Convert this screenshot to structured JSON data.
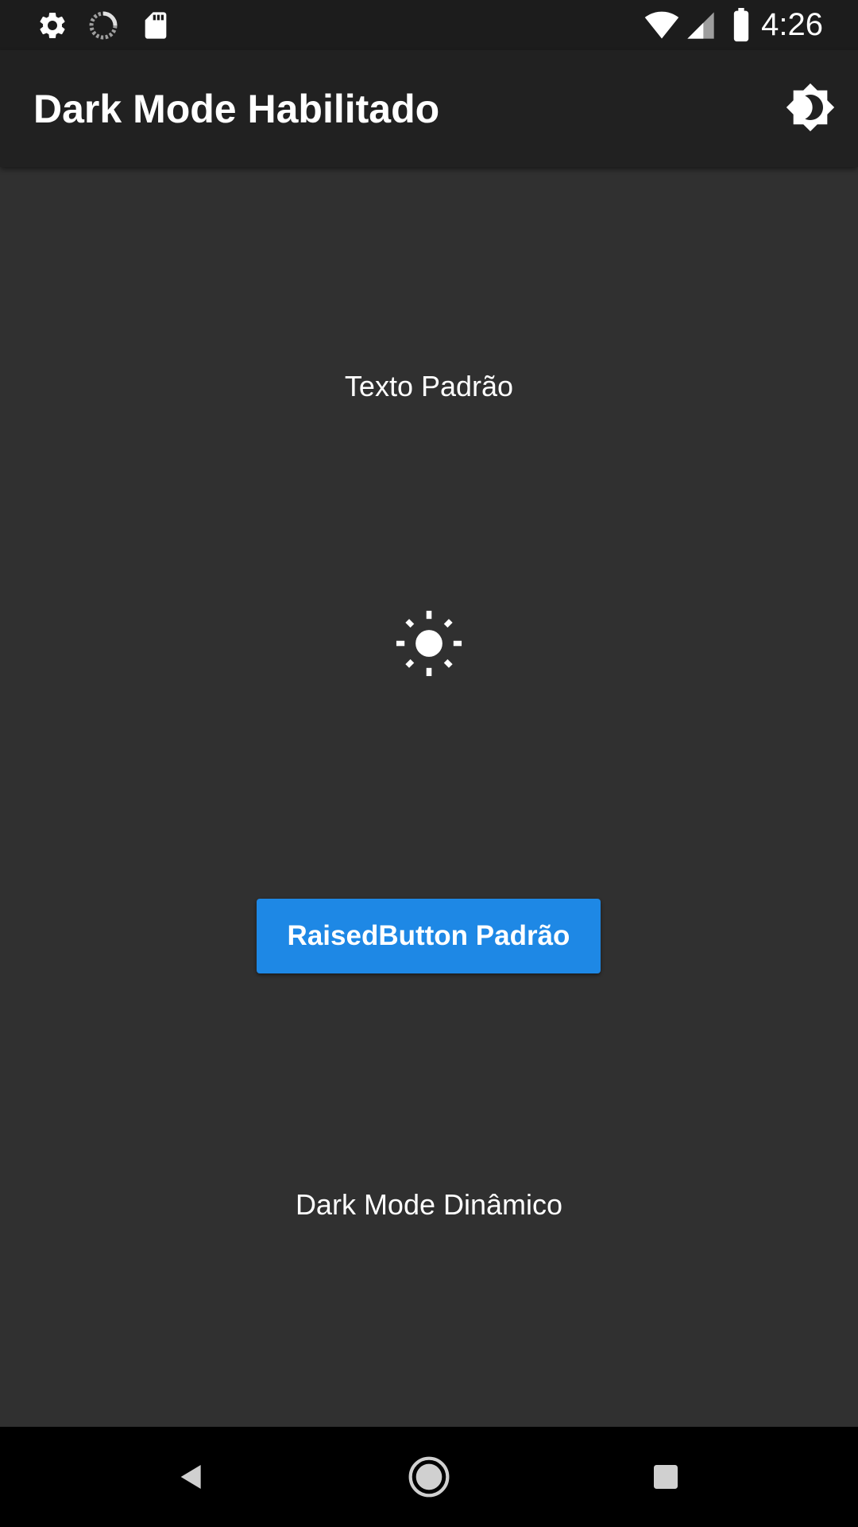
{
  "status_bar": {
    "time": "4:26",
    "left_icons": [
      "gear-icon",
      "sync-progress-icon",
      "sd-card-icon"
    ],
    "right_icons": [
      "wifi-icon",
      "cell-signal-icon",
      "battery-icon"
    ]
  },
  "app_bar": {
    "title": "Dark Mode Habilitado",
    "action_icon": "brightness-toggle-icon"
  },
  "content": {
    "default_text": "Texto Padrão",
    "center_icon": "sun-icon",
    "button_label": "RaisedButton Padrão",
    "dynamic_text": "Dark Mode Dinâmico"
  },
  "nav_bar": {
    "icons": [
      "back-icon",
      "home-icon",
      "recents-icon"
    ]
  },
  "colors": {
    "background": "#303030",
    "app_bar": "#212121",
    "status_bar": "#1c1c1c",
    "button": "#1e88e5",
    "text": "#ffffff"
  }
}
